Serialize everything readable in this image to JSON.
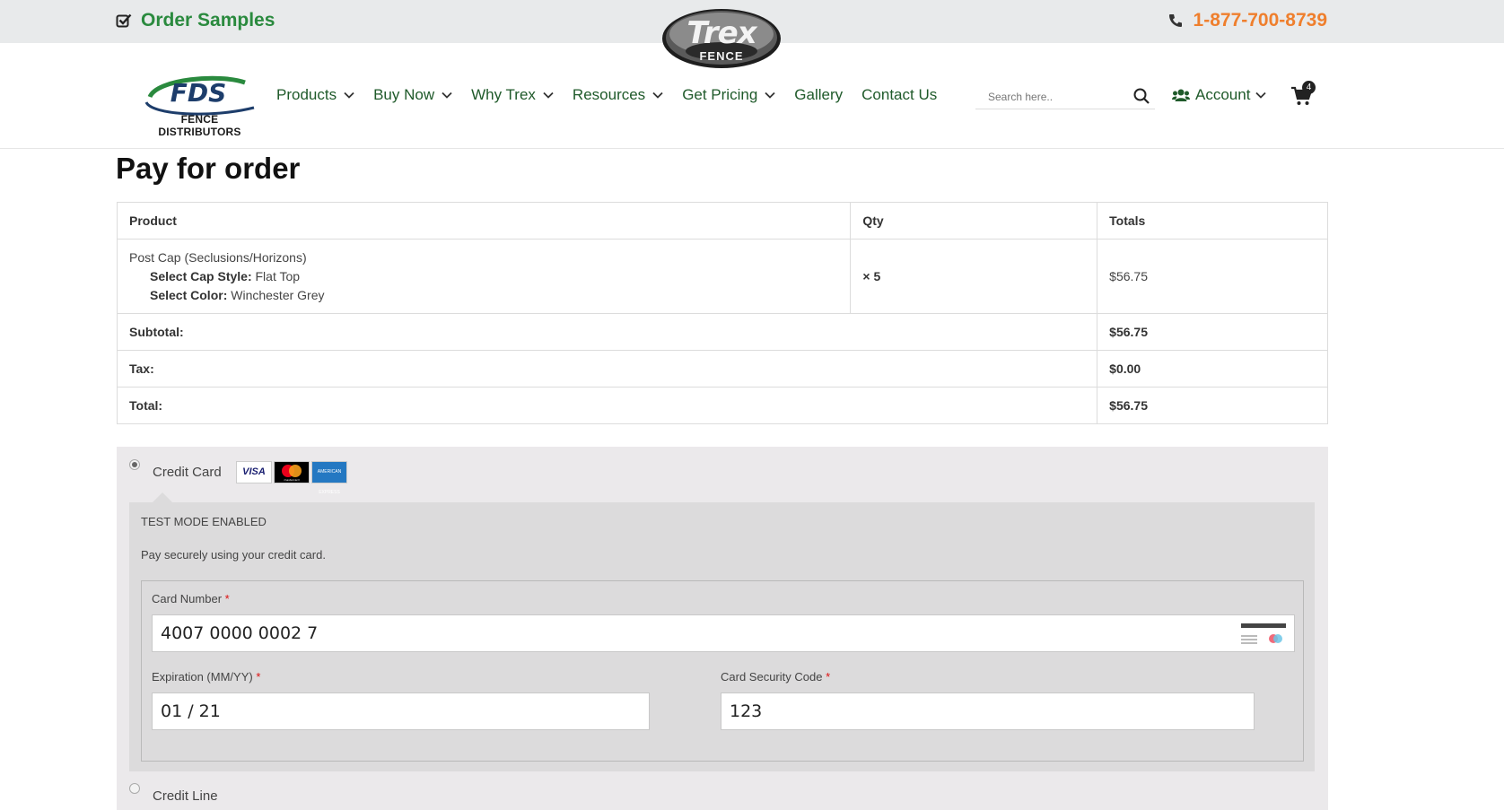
{
  "topbar": {
    "order_samples": "Order Samples",
    "phone": "1-877-700-8739",
    "brand_logo_text": "Trex",
    "brand_logo_sub": "FENCE"
  },
  "navbar": {
    "logo_text": "FDS",
    "logo_sub": "FENCE DISTRIBUTORS",
    "items": [
      {
        "label": "Products",
        "dropdown": true
      },
      {
        "label": "Buy Now",
        "dropdown": true
      },
      {
        "label": "Why Trex",
        "dropdown": true
      },
      {
        "label": "Resources",
        "dropdown": true
      },
      {
        "label": "Get Pricing",
        "dropdown": true
      },
      {
        "label": "Gallery",
        "dropdown": false
      },
      {
        "label": "Contact Us",
        "dropdown": false
      }
    ],
    "search_placeholder": "Search here..",
    "account_label": "Account",
    "cart_count": "4"
  },
  "page": {
    "title": "Pay for order"
  },
  "order_table": {
    "headers": {
      "product": "Product",
      "qty": "Qty",
      "totals": "Totals"
    },
    "item": {
      "name": "Post Cap (Seclusions/Horizons)",
      "meta": [
        {
          "key": "Select Cap Style:",
          "value": "Flat Top"
        },
        {
          "key": "Select Color:",
          "value": "Winchester Grey"
        }
      ],
      "qty": "× 5",
      "total": "$56.75"
    },
    "subtotal": {
      "label": "Subtotal:",
      "value": "$56.75"
    },
    "tax": {
      "label": "Tax:",
      "value": "$0.00"
    },
    "total": {
      "label": "Total:",
      "value": "$56.75"
    }
  },
  "payment": {
    "credit_card_label": "Credit Card",
    "card_brands": [
      "VISA",
      "mastercard",
      "AMERICAN EXPRESS"
    ],
    "test_mode": "TEST MODE ENABLED",
    "description": "Pay securely using your credit card.",
    "card_number_label": "Card Number",
    "card_number_value": "4007 0000 0002 7",
    "expiration_label": "Expiration (MM/YY)",
    "expiration_value": "01 / 21",
    "cvc_label": "Card Security Code",
    "cvc_value": "123",
    "required_mark": "*",
    "credit_line_label": "Credit Line"
  },
  "colors": {
    "nav_green": "#1f5a2a",
    "samples_green": "#2a8a3e",
    "phone_orange": "#ef7f2d",
    "topbar_bg": "#e8eaeb",
    "payment_bg": "#ebe9eb"
  }
}
